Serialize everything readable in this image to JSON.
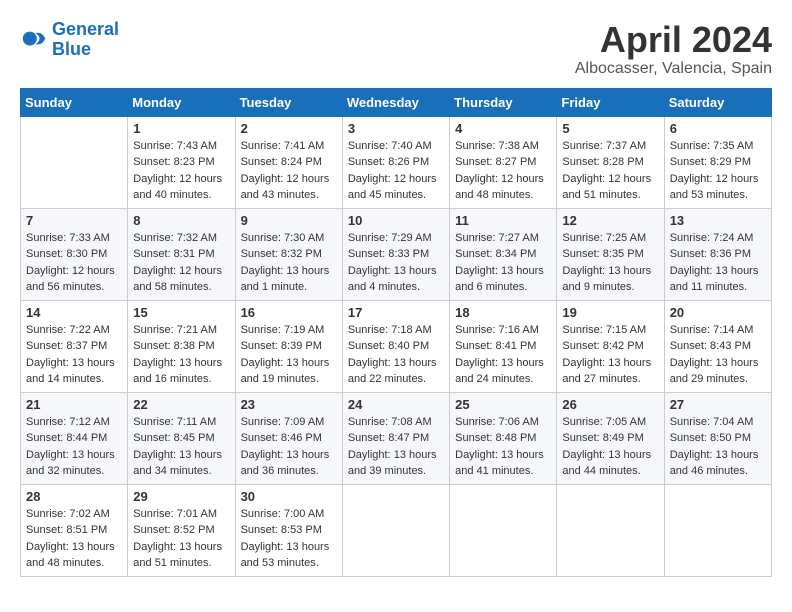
{
  "header": {
    "logo_line1": "General",
    "logo_line2": "Blue",
    "month_year": "April 2024",
    "location": "Albocasser, Valencia, Spain"
  },
  "weekdays": [
    "Sunday",
    "Monday",
    "Tuesday",
    "Wednesday",
    "Thursday",
    "Friday",
    "Saturday"
  ],
  "weeks": [
    [
      {
        "day": "",
        "info": ""
      },
      {
        "day": "1",
        "info": "Sunrise: 7:43 AM\nSunset: 8:23 PM\nDaylight: 12 hours\nand 40 minutes."
      },
      {
        "day": "2",
        "info": "Sunrise: 7:41 AM\nSunset: 8:24 PM\nDaylight: 12 hours\nand 43 minutes."
      },
      {
        "day": "3",
        "info": "Sunrise: 7:40 AM\nSunset: 8:26 PM\nDaylight: 12 hours\nand 45 minutes."
      },
      {
        "day": "4",
        "info": "Sunrise: 7:38 AM\nSunset: 8:27 PM\nDaylight: 12 hours\nand 48 minutes."
      },
      {
        "day": "5",
        "info": "Sunrise: 7:37 AM\nSunset: 8:28 PM\nDaylight: 12 hours\nand 51 minutes."
      },
      {
        "day": "6",
        "info": "Sunrise: 7:35 AM\nSunset: 8:29 PM\nDaylight: 12 hours\nand 53 minutes."
      }
    ],
    [
      {
        "day": "7",
        "info": "Sunrise: 7:33 AM\nSunset: 8:30 PM\nDaylight: 12 hours\nand 56 minutes."
      },
      {
        "day": "8",
        "info": "Sunrise: 7:32 AM\nSunset: 8:31 PM\nDaylight: 12 hours\nand 58 minutes."
      },
      {
        "day": "9",
        "info": "Sunrise: 7:30 AM\nSunset: 8:32 PM\nDaylight: 13 hours\nand 1 minute."
      },
      {
        "day": "10",
        "info": "Sunrise: 7:29 AM\nSunset: 8:33 PM\nDaylight: 13 hours\nand 4 minutes."
      },
      {
        "day": "11",
        "info": "Sunrise: 7:27 AM\nSunset: 8:34 PM\nDaylight: 13 hours\nand 6 minutes."
      },
      {
        "day": "12",
        "info": "Sunrise: 7:25 AM\nSunset: 8:35 PM\nDaylight: 13 hours\nand 9 minutes."
      },
      {
        "day": "13",
        "info": "Sunrise: 7:24 AM\nSunset: 8:36 PM\nDaylight: 13 hours\nand 11 minutes."
      }
    ],
    [
      {
        "day": "14",
        "info": "Sunrise: 7:22 AM\nSunset: 8:37 PM\nDaylight: 13 hours\nand 14 minutes."
      },
      {
        "day": "15",
        "info": "Sunrise: 7:21 AM\nSunset: 8:38 PM\nDaylight: 13 hours\nand 16 minutes."
      },
      {
        "day": "16",
        "info": "Sunrise: 7:19 AM\nSunset: 8:39 PM\nDaylight: 13 hours\nand 19 minutes."
      },
      {
        "day": "17",
        "info": "Sunrise: 7:18 AM\nSunset: 8:40 PM\nDaylight: 13 hours\nand 22 minutes."
      },
      {
        "day": "18",
        "info": "Sunrise: 7:16 AM\nSunset: 8:41 PM\nDaylight: 13 hours\nand 24 minutes."
      },
      {
        "day": "19",
        "info": "Sunrise: 7:15 AM\nSunset: 8:42 PM\nDaylight: 13 hours\nand 27 minutes."
      },
      {
        "day": "20",
        "info": "Sunrise: 7:14 AM\nSunset: 8:43 PM\nDaylight: 13 hours\nand 29 minutes."
      }
    ],
    [
      {
        "day": "21",
        "info": "Sunrise: 7:12 AM\nSunset: 8:44 PM\nDaylight: 13 hours\nand 32 minutes."
      },
      {
        "day": "22",
        "info": "Sunrise: 7:11 AM\nSunset: 8:45 PM\nDaylight: 13 hours\nand 34 minutes."
      },
      {
        "day": "23",
        "info": "Sunrise: 7:09 AM\nSunset: 8:46 PM\nDaylight: 13 hours\nand 36 minutes."
      },
      {
        "day": "24",
        "info": "Sunrise: 7:08 AM\nSunset: 8:47 PM\nDaylight: 13 hours\nand 39 minutes."
      },
      {
        "day": "25",
        "info": "Sunrise: 7:06 AM\nSunset: 8:48 PM\nDaylight: 13 hours\nand 41 minutes."
      },
      {
        "day": "26",
        "info": "Sunrise: 7:05 AM\nSunset: 8:49 PM\nDaylight: 13 hours\nand 44 minutes."
      },
      {
        "day": "27",
        "info": "Sunrise: 7:04 AM\nSunset: 8:50 PM\nDaylight: 13 hours\nand 46 minutes."
      }
    ],
    [
      {
        "day": "28",
        "info": "Sunrise: 7:02 AM\nSunset: 8:51 PM\nDaylight: 13 hours\nand 48 minutes."
      },
      {
        "day": "29",
        "info": "Sunrise: 7:01 AM\nSunset: 8:52 PM\nDaylight: 13 hours\nand 51 minutes."
      },
      {
        "day": "30",
        "info": "Sunrise: 7:00 AM\nSunset: 8:53 PM\nDaylight: 13 hours\nand 53 minutes."
      },
      {
        "day": "",
        "info": ""
      },
      {
        "day": "",
        "info": ""
      },
      {
        "day": "",
        "info": ""
      },
      {
        "day": "",
        "info": ""
      }
    ]
  ]
}
